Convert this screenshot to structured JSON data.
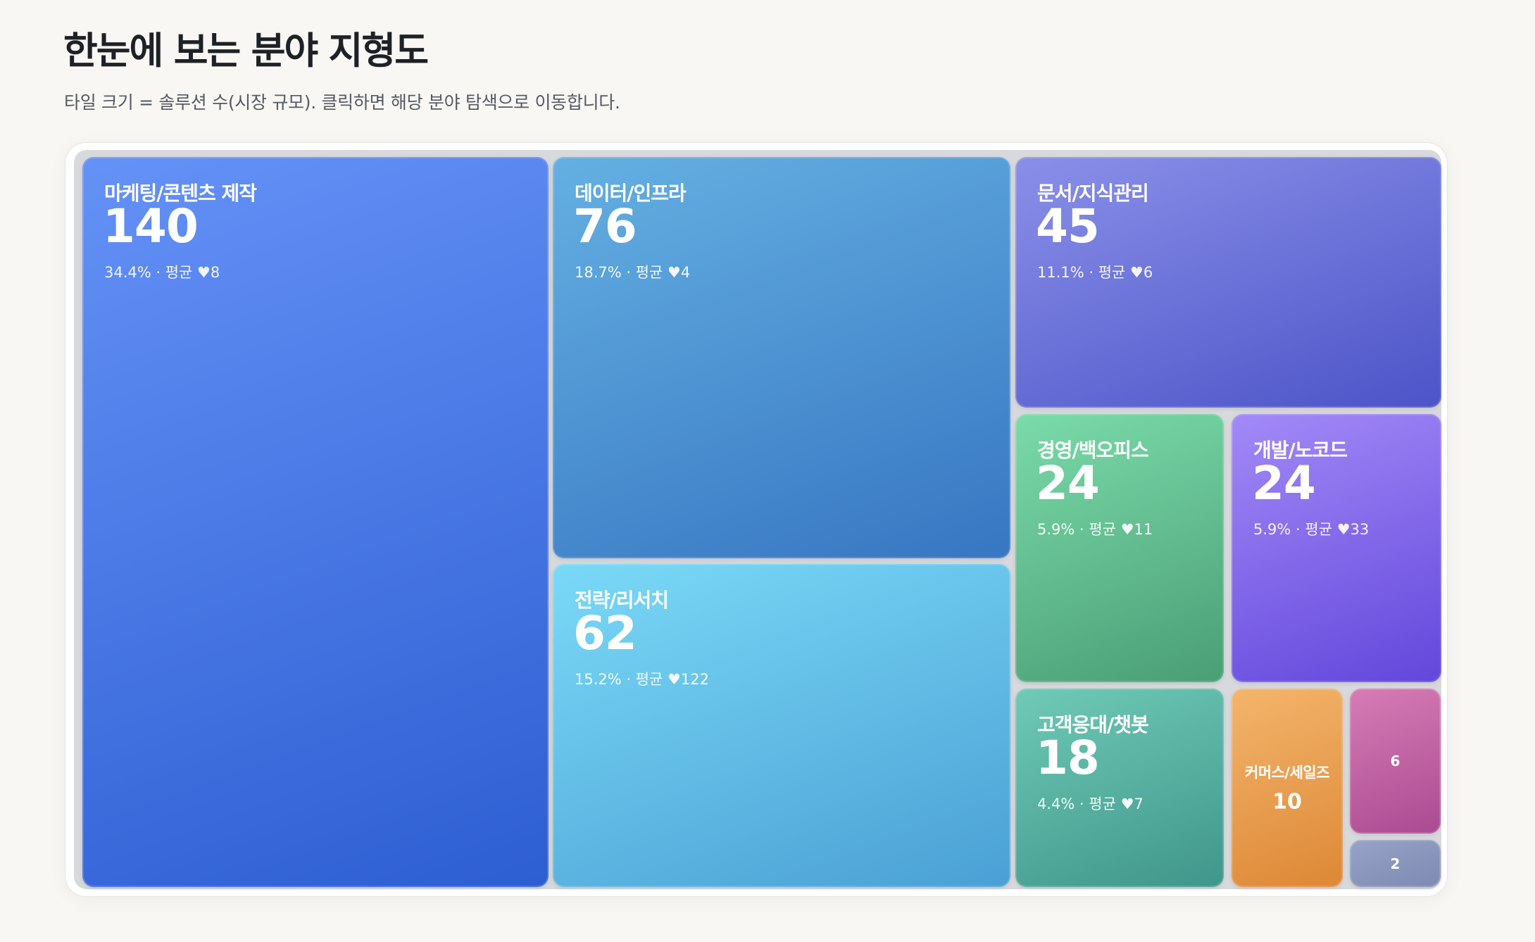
{
  "page": {
    "title": "한눈에 보는 분야 지형도",
    "subtitle": "타일 크기 = 솔루션 수(시장 규모). 클릭하면 해당 분야 탐색으로 이동합니다."
  },
  "chart_data": {
    "type": "treemap",
    "title": "",
    "value_label": "솔루션 수",
    "items": [
      {
        "name": "마케팅/콘텐츠 제작",
        "value": 140,
        "share": "34.4%",
        "avg_likes": 8,
        "meta": "34.4% · 평균 ♥8",
        "color_from": "#6592f7",
        "color_to": "#2d5ed2"
      },
      {
        "name": "데이터/인프라",
        "value": 76,
        "share": "18.7%",
        "avg_likes": 4,
        "meta": "18.7% · 평균 ♥4",
        "color_from": "#64b0e2",
        "color_to": "#3776c2"
      },
      {
        "name": "전략/리서치",
        "value": 62,
        "share": "15.2%",
        "avg_likes": 122,
        "meta": "15.2% · 평균 ♥122",
        "color_from": "#7ad9f7",
        "color_to": "#4aa0d4"
      },
      {
        "name": "문서/지식관리",
        "value": 45,
        "share": "11.1%",
        "avg_likes": 6,
        "meta": "11.1% · 평균 ♥6",
        "color_from": "#8a90e8",
        "color_to": "#4c54c8"
      },
      {
        "name": "경영/백오피스",
        "value": 24,
        "share": "5.9%",
        "avg_likes": 11,
        "meta": "5.9% · 평균 ♥11",
        "color_from": "#7bdba9",
        "color_to": "#4a9e76"
      },
      {
        "name": "개발/노코드",
        "value": 24,
        "share": "5.9%",
        "avg_likes": 33,
        "meta": "5.9% · 평균 ♥33",
        "color_from": "#a38af7",
        "color_to": "#6247db"
      },
      {
        "name": "고객응대/챗봇",
        "value": 18,
        "share": "4.4%",
        "avg_likes": 7,
        "meta": "4.4% · 평균 ♥7",
        "color_from": "#6fcab6",
        "color_to": "#3f968a"
      },
      {
        "name": "커머스/세일즈",
        "value": 10,
        "share": "",
        "avg_likes": null,
        "meta": "",
        "color_from": "#f3b56c",
        "color_to": "#dd8835"
      },
      {
        "name": "",
        "value": 6,
        "share": "",
        "avg_likes": null,
        "meta": "",
        "color_from": "#d77cb5",
        "color_to": "#aa4b92"
      },
      {
        "name": "",
        "value": 2,
        "share": "",
        "avg_likes": null,
        "meta": "",
        "color_from": "#97a3c8",
        "color_to": "#7d8ab1"
      }
    ]
  }
}
